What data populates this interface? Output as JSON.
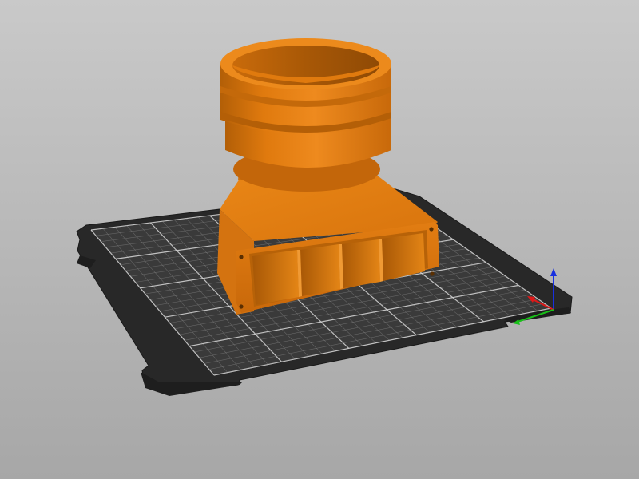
{
  "scene": {
    "background_top": "#c8c8c8",
    "background_bottom": "#a6a6a6",
    "model_color": "#e07a0e",
    "model_shadow": "#a95a06",
    "model_highlight": "#f29a3a",
    "bed_color": "#2b2b2b",
    "bed_border": "#1a1a1a",
    "grid_color": "#8a8a8a",
    "axis_x_color": "#e01818",
    "axis_y_color": "#18c018",
    "axis_z_color": "#1830e0"
  },
  "icons": {
    "axes_gizmo": "xyz-axes-icon"
  }
}
